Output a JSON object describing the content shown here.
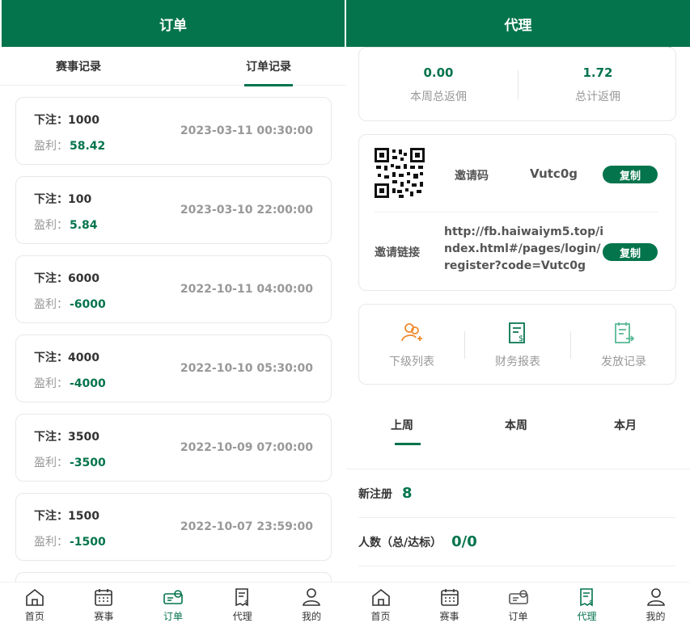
{
  "colors": {
    "brand": "#04744c",
    "muted": "#999999"
  },
  "left": {
    "title": "订单",
    "tabs": [
      {
        "label": "赛事记录",
        "active": false
      },
      {
        "label": "订单记录",
        "active": true
      }
    ],
    "orders": [
      {
        "bet_label": "下注：",
        "bet": "1000",
        "profit_label": "盈利：",
        "profit": "58.42",
        "time": "2023-03-11 00:30:00"
      },
      {
        "bet_label": "下注：",
        "bet": "100",
        "profit_label": "盈利：",
        "profit": "5.84",
        "time": "2023-03-10 22:00:00"
      },
      {
        "bet_label": "下注：",
        "bet": "6000",
        "profit_label": "盈利：",
        "profit": "-6000",
        "time": "2022-10-11 04:00:00"
      },
      {
        "bet_label": "下注：",
        "bet": "4000",
        "profit_label": "盈利：",
        "profit": "-4000",
        "time": "2022-10-10 05:30:00"
      },
      {
        "bet_label": "下注：",
        "bet": "3500",
        "profit_label": "盈利：",
        "profit": "-3500",
        "time": "2022-10-09 07:00:00"
      },
      {
        "bet_label": "下注：",
        "bet": "1500",
        "profit_label": "盈利：",
        "profit": "-1500",
        "time": "2022-10-07 23:59:00"
      }
    ],
    "nav": [
      {
        "label": "首页",
        "icon": "home-icon",
        "active": false
      },
      {
        "label": "赛事",
        "icon": "calendar-icon",
        "active": false
      },
      {
        "label": "订单",
        "icon": "ticket-icon",
        "active": true
      },
      {
        "label": "代理",
        "icon": "receipt-icon",
        "active": false
      },
      {
        "label": "我的",
        "icon": "user-icon",
        "active": false
      }
    ]
  },
  "right": {
    "title": "代理",
    "stats": [
      {
        "value": "0.00",
        "label": "本周总返佣"
      },
      {
        "value": "1.72",
        "label": "总计返佣"
      }
    ],
    "invite": {
      "code_label": "邀请码",
      "code": "Vutc0g",
      "copy_label": "复制",
      "link_label": "邀请链接",
      "link": "http://fb.haiwaiym5.top/index.html#/pages/login/register?code=Vutc0g",
      "link_copy_label": "复制"
    },
    "tools": [
      {
        "label": "下级列表",
        "icon": "team-add-icon"
      },
      {
        "label": "财务报表",
        "icon": "finance-report-icon"
      },
      {
        "label": "发放记录",
        "icon": "payout-record-icon"
      }
    ],
    "periods": [
      {
        "label": "上周",
        "active": true
      },
      {
        "label": "本周",
        "active": false
      },
      {
        "label": "本月",
        "active": false
      }
    ],
    "metrics": [
      {
        "label": "新注册",
        "value": "8"
      },
      {
        "label": "人数（总/达标）",
        "value": "0/0"
      }
    ],
    "nav": [
      {
        "label": "首页",
        "icon": "home-icon",
        "active": false
      },
      {
        "label": "赛事",
        "icon": "calendar-icon",
        "active": false
      },
      {
        "label": "订单",
        "icon": "ticket-icon",
        "active": false
      },
      {
        "label": "代理",
        "icon": "receipt-icon",
        "active": true
      },
      {
        "label": "我的",
        "icon": "user-icon",
        "active": false
      }
    ]
  }
}
